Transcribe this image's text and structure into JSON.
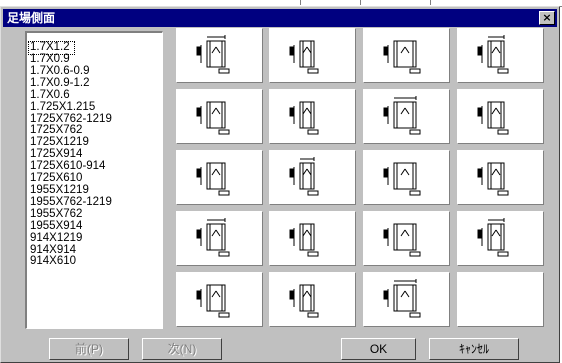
{
  "dialog": {
    "title": "足場側面",
    "close_glyph": "×"
  },
  "list": {
    "items": [
      "1.7X1.2",
      "1.7X0.9",
      "1.7X0.6-0.9",
      "1.7X0.9-1.2",
      "1.7X0.6",
      "1.725X1.215",
      "1725X762-1219",
      "1725X762",
      "1725X1219",
      "1725X914",
      "1725X610-914",
      "1725X610",
      "1955X1219",
      "1955X762-1219",
      "1955X762",
      "1955X914",
      "914X1219",
      "914X914",
      "914X610"
    ],
    "selected_index": 0
  },
  "thumbnails": {
    "count": 20,
    "empty_last": true
  },
  "buttons": {
    "prev": "前(P)",
    "next": "次(N)",
    "ok": "OK",
    "cancel": "ｷｬﾝｾﾙ"
  }
}
